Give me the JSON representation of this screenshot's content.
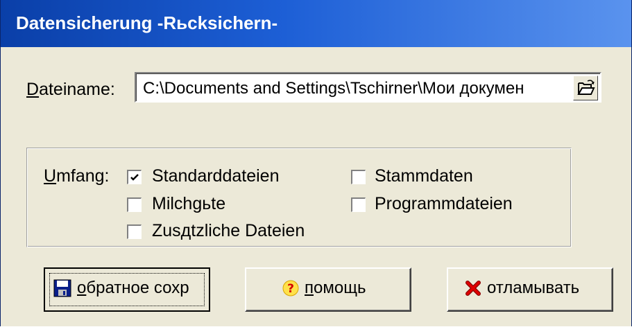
{
  "window": {
    "title": "Datensicherung  -Rьcksichern-"
  },
  "file": {
    "label_accel": "D",
    "label_rest": "ateiname:",
    "value": "C:\\Documents and Settings\\Tschirner\\Мои докумен",
    "browse_icon": "open-folder-icon"
  },
  "scope": {
    "label_accel": "U",
    "label_rest": "mfang:",
    "options": [
      {
        "label": "Standarddateien",
        "checked": true
      },
      {
        "label": "Stammdaten",
        "checked": false
      },
      {
        "label": "Milchgьte",
        "checked": false
      },
      {
        "label": "Programmdateien",
        "checked": false
      },
      {
        "label": "Zusдtzliche Dateien",
        "checked": false
      }
    ]
  },
  "buttons": {
    "restore": {
      "accel": "о",
      "rest": "братное сохр",
      "icon": "floppy-disk-icon"
    },
    "help": {
      "accel": "п",
      "rest": "омощь",
      "icon": "question-mark-icon"
    },
    "cancel": {
      "label": "отламывать",
      "icon": "red-x-icon"
    }
  },
  "colors": {
    "titlebar_start": "#0a3fa8",
    "titlebar_end": "#5a93ee",
    "dialog_face": "#ece9d8"
  }
}
